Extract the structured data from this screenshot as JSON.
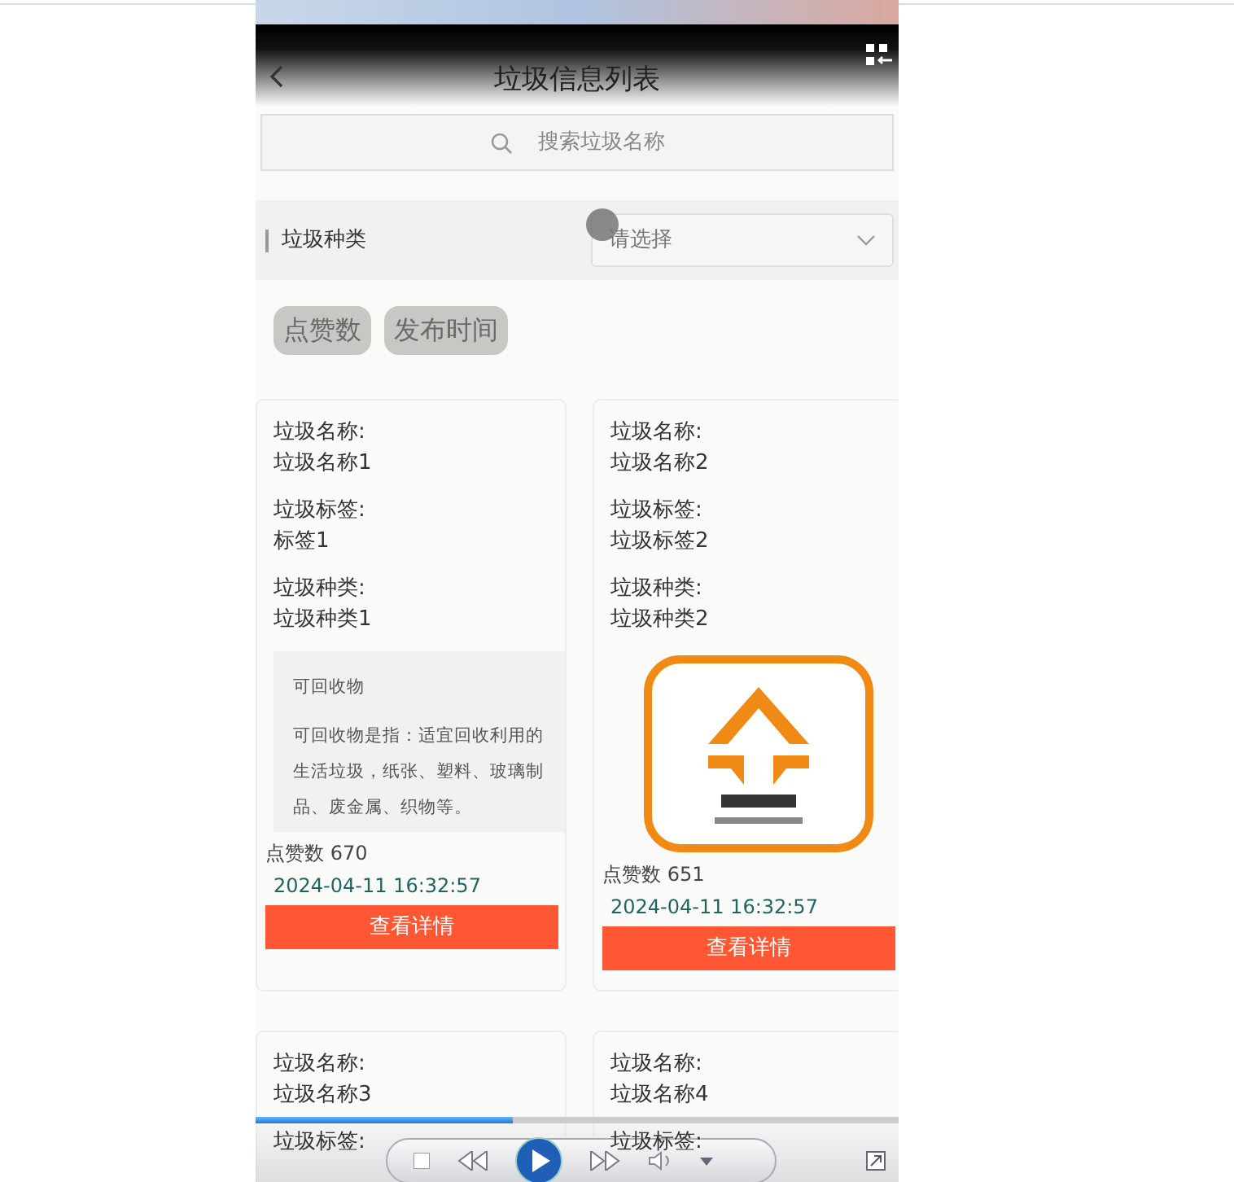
{
  "header": {
    "title": "垃圾信息列表"
  },
  "search": {
    "placeholder": "搜索垃圾名称"
  },
  "filter": {
    "label": "垃圾种类",
    "placeholder": "请选择"
  },
  "sort_buttons": [
    {
      "label": "点赞数"
    },
    {
      "label": "发布时间"
    }
  ],
  "cards": [
    {
      "kind": "text",
      "fields": [
        {
          "label": "垃圾名称:",
          "value": "垃圾名称1"
        },
        {
          "label": "垃圾标签:",
          "value": "标签1"
        },
        {
          "label": "垃圾种类:",
          "value": "垃圾种类1"
        }
      ],
      "info_title": "可回收物",
      "info_text": "可回收物是指：适宜回收利用的生活垃圾，纸张、塑料、玻璃制品、废金属、织物等。",
      "likes_label": "点赞数",
      "likes": "670",
      "date": "2024-04-11 16:32:57",
      "button": "查看详情"
    },
    {
      "kind": "picture",
      "fields": [
        {
          "label": "垃圾名称:",
          "value": "垃圾名称2"
        },
        {
          "label": "垃圾标签:",
          "value": "垃圾标签2"
        },
        {
          "label": "垃圾种类:",
          "value": "垃圾种类2"
        }
      ],
      "likes_label": "点赞数",
      "likes": "651",
      "date": "2024-04-11 16:32:57",
      "button": "查看详情"
    },
    {
      "fields": [
        {
          "label": "垃圾名称:",
          "value": "垃圾名称3"
        },
        {
          "label": "垃圾标签:"
        }
      ]
    },
    {
      "fields": [
        {
          "label": "垃圾名称:",
          "value": "垃圾名称4"
        },
        {
          "label": "垃圾标签:"
        }
      ]
    }
  ],
  "player": {
    "level": 0.4
  }
}
